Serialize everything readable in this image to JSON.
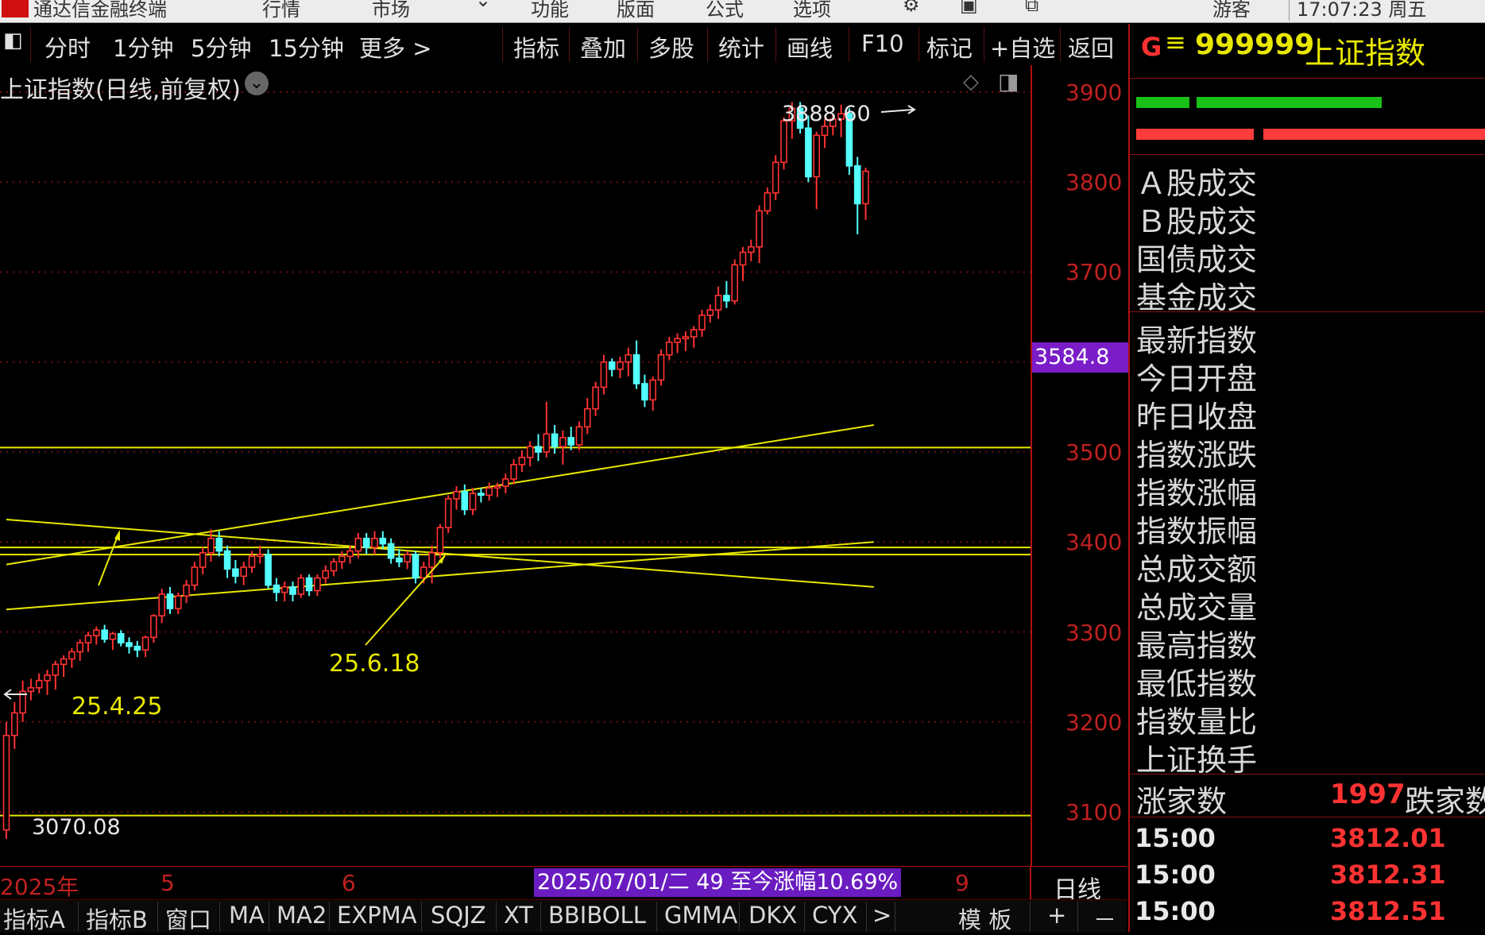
{
  "titlebar": {
    "app_title": "通达信金融终端",
    "menus": [
      "行情",
      "市场",
      "功能",
      "版面",
      "公式",
      "选项"
    ],
    "user": "游客",
    "clock": "17:07:23 周五"
  },
  "toolbar": {
    "periods": [
      "分时",
      "1分钟",
      "5分钟",
      "15分钟",
      "更多 >"
    ],
    "tools": [
      "指标",
      "叠加",
      "多股",
      "统计",
      "画线",
      "F10",
      "标记",
      "+自选",
      "返回"
    ]
  },
  "chart": {
    "header_title": "上证指数(日线,前复权)",
    "price_tag": "3584.8",
    "high_label": "3888.60",
    "low_label": "3070.08",
    "annotations": [
      "25.4.25",
      "25.6.18"
    ],
    "bottom_info": "2025/07/01/二 49 至今涨幅10.69%",
    "period_label": "日线",
    "x_labels": [
      "2025年",
      "5",
      "6",
      "9"
    ]
  },
  "chart_data": {
    "type": "candlestick",
    "ylim": [
      3040,
      3930
    ],
    "yticks": [
      3100,
      3200,
      3300,
      3400,
      3500,
      3600,
      3700,
      3800,
      3900
    ],
    "bars": [
      [
        3080,
        3200,
        3070,
        3185
      ],
      [
        3185,
        3222,
        3170,
        3210
      ],
      [
        3210,
        3246,
        3200,
        3234
      ],
      [
        3234,
        3248,
        3224,
        3238
      ],
      [
        3238,
        3254,
        3232,
        3246
      ],
      [
        3246,
        3258,
        3230,
        3252
      ],
      [
        3252,
        3268,
        3236,
        3264
      ],
      [
        3264,
        3274,
        3250,
        3270
      ],
      [
        3270,
        3282,
        3260,
        3278
      ],
      [
        3278,
        3292,
        3268,
        3288
      ],
      [
        3288,
        3300,
        3278,
        3296
      ],
      [
        3296,
        3306,
        3286,
        3302
      ],
      [
        3302,
        3308,
        3288,
        3292
      ],
      [
        3292,
        3300,
        3280,
        3298
      ],
      [
        3298,
        3302,
        3284,
        3288
      ],
      [
        3288,
        3294,
        3276,
        3284
      ],
      [
        3284,
        3290,
        3272,
        3280
      ],
      [
        3280,
        3296,
        3272,
        3294
      ],
      [
        3294,
        3320,
        3288,
        3318
      ],
      [
        3318,
        3348,
        3310,
        3342
      ],
      [
        3342,
        3350,
        3320,
        3326
      ],
      [
        3326,
        3344,
        3320,
        3340
      ],
      [
        3340,
        3358,
        3332,
        3352
      ],
      [
        3352,
        3378,
        3346,
        3372
      ],
      [
        3372,
        3394,
        3364,
        3388
      ],
      [
        3388,
        3414,
        3378,
        3404
      ],
      [
        3404,
        3412,
        3384,
        3390
      ],
      [
        3390,
        3396,
        3360,
        3370
      ],
      [
        3370,
        3380,
        3354,
        3362
      ],
      [
        3362,
        3378,
        3352,
        3372
      ],
      [
        3372,
        3390,
        3366,
        3384
      ],
      [
        3384,
        3396,
        3376,
        3386
      ],
      [
        3386,
        3392,
        3348,
        3352
      ],
      [
        3352,
        3360,
        3334,
        3344
      ],
      [
        3344,
        3356,
        3334,
        3350
      ],
      [
        3350,
        3356,
        3334,
        3342
      ],
      [
        3342,
        3364,
        3338,
        3360
      ],
      [
        3360,
        3364,
        3340,
        3346
      ],
      [
        3346,
        3364,
        3340,
        3360
      ],
      [
        3360,
        3374,
        3354,
        3368
      ],
      [
        3368,
        3382,
        3362,
        3378
      ],
      [
        3378,
        3390,
        3370,
        3384
      ],
      [
        3384,
        3396,
        3376,
        3390
      ],
      [
        3390,
        3410,
        3382,
        3404
      ],
      [
        3404,
        3410,
        3386,
        3394
      ],
      [
        3394,
        3412,
        3386,
        3404
      ],
      [
        3404,
        3412,
        3392,
        3398
      ],
      [
        3398,
        3404,
        3376,
        3382
      ],
      [
        3382,
        3392,
        3372,
        3378
      ],
      [
        3378,
        3390,
        3370,
        3386
      ],
      [
        3386,
        3390,
        3354,
        3360
      ],
      [
        3360,
        3378,
        3354,
        3372
      ],
      [
        3372,
        3396,
        3354,
        3388
      ],
      [
        3388,
        3420,
        3382,
        3416
      ],
      [
        3416,
        3452,
        3410,
        3448
      ],
      [
        3448,
        3462,
        3436,
        3456
      ],
      [
        3456,
        3464,
        3430,
        3436
      ],
      [
        3436,
        3460,
        3430,
        3454
      ],
      [
        3454,
        3460,
        3444,
        3452
      ],
      [
        3452,
        3466,
        3446,
        3460
      ],
      [
        3460,
        3466,
        3450,
        3462
      ],
      [
        3462,
        3476,
        3454,
        3470
      ],
      [
        3470,
        3492,
        3464,
        3486
      ],
      [
        3486,
        3502,
        3478,
        3494
      ],
      [
        3494,
        3512,
        3484,
        3506
      ],
      [
        3506,
        3520,
        3490,
        3500
      ],
      [
        3500,
        3556,
        3494,
        3520
      ],
      [
        3520,
        3530,
        3498,
        3506
      ],
      [
        3506,
        3524,
        3486,
        3516
      ],
      [
        3516,
        3528,
        3502,
        3508
      ],
      [
        3508,
        3534,
        3502,
        3528
      ],
      [
        3528,
        3560,
        3520,
        3548
      ],
      [
        3548,
        3578,
        3540,
        3572
      ],
      [
        3572,
        3608,
        3564,
        3600
      ],
      [
        3600,
        3604,
        3584,
        3592
      ],
      [
        3592,
        3606,
        3582,
        3600
      ],
      [
        3600,
        3616,
        3584,
        3608
      ],
      [
        3608,
        3624,
        3570,
        3576
      ],
      [
        3576,
        3586,
        3550,
        3558
      ],
      [
        3558,
        3584,
        3546,
        3580
      ],
      [
        3580,
        3614,
        3574,
        3608
      ],
      [
        3608,
        3628,
        3602,
        3622
      ],
      [
        3622,
        3632,
        3610,
        3626
      ],
      [
        3626,
        3634,
        3612,
        3628
      ],
      [
        3628,
        3640,
        3616,
        3636
      ],
      [
        3636,
        3658,
        3628,
        3652
      ],
      [
        3652,
        3664,
        3644,
        3658
      ],
      [
        3658,
        3684,
        3648,
        3674
      ],
      [
        3674,
        3690,
        3660,
        3668
      ],
      [
        3668,
        3714,
        3664,
        3708
      ],
      [
        3708,
        3728,
        3690,
        3722
      ],
      [
        3722,
        3736,
        3712,
        3728
      ],
      [
        3728,
        3774,
        3710,
        3768
      ],
      [
        3768,
        3794,
        3764,
        3788
      ],
      [
        3788,
        3830,
        3780,
        3822
      ],
      [
        3822,
        3872,
        3814,
        3868
      ],
      [
        3868,
        3889,
        3848,
        3882
      ],
      [
        3882,
        3889,
        3854,
        3860
      ],
      [
        3860,
        3874,
        3800,
        3806
      ],
      [
        3806,
        3856,
        3770,
        3852
      ],
      [
        3852,
        3870,
        3838,
        3862
      ],
      [
        3862,
        3876,
        3852,
        3870
      ],
      [
        3870,
        3886,
        3850,
        3876
      ],
      [
        3876,
        3882,
        3808,
        3818
      ],
      [
        3818,
        3828,
        3742,
        3776
      ],
      [
        3776,
        3816,
        3758,
        3812
      ]
    ],
    "trendlines": [
      {
        "from": [
          0,
          3425
        ],
        "to": [
          106,
          3350
        ]
      },
      {
        "from": [
          0,
          3375
        ],
        "to": [
          106,
          3530
        ]
      },
      {
        "from": [
          0,
          3325
        ],
        "to": [
          106,
          3400
        ]
      }
    ],
    "hlines": [
      3505,
      3394,
      3386,
      3096
    ],
    "colors": {
      "up": "#ff3232",
      "down": "#54ffff",
      "line": "#e8e800"
    }
  },
  "right_panel": {
    "code_icon": "G",
    "code": "999999",
    "name": "上证指数",
    "bars": {
      "green_left_pct": 0.15,
      "green_right_pct": 0.52,
      "red_left_pct": 0.33,
      "red_right_pct": 0.63
    },
    "labels1": [
      "Ａ股成交",
      "Ｂ股成交",
      "国债成交",
      "基金成交"
    ],
    "labels2": [
      "最新指数",
      "今日开盘",
      "昨日收盘",
      "指数涨跌",
      "指数涨幅",
      "指数振幅",
      "总成交额",
      "总成交量",
      "最高指数",
      "最低指数",
      "指数量比",
      "上证换手"
    ],
    "breadth": {
      "up_label": "涨家数",
      "up_value": "1997",
      "down_label": "跌家数"
    },
    "ticks": [
      {
        "time": "15:00",
        "value": "3812.01"
      },
      {
        "time": "15:00",
        "value": "3812.31"
      },
      {
        "time": "15:00",
        "value": "3812.51"
      }
    ]
  },
  "bottom_tabs": [
    "指标A",
    "指标B",
    "窗口",
    "MA",
    "MA2",
    "EXPMA",
    "SQJZ",
    "XT",
    "BBIBOLL",
    "GMMA",
    "DKX",
    "CYX",
    ">",
    "模 板",
    "+",
    "－"
  ]
}
